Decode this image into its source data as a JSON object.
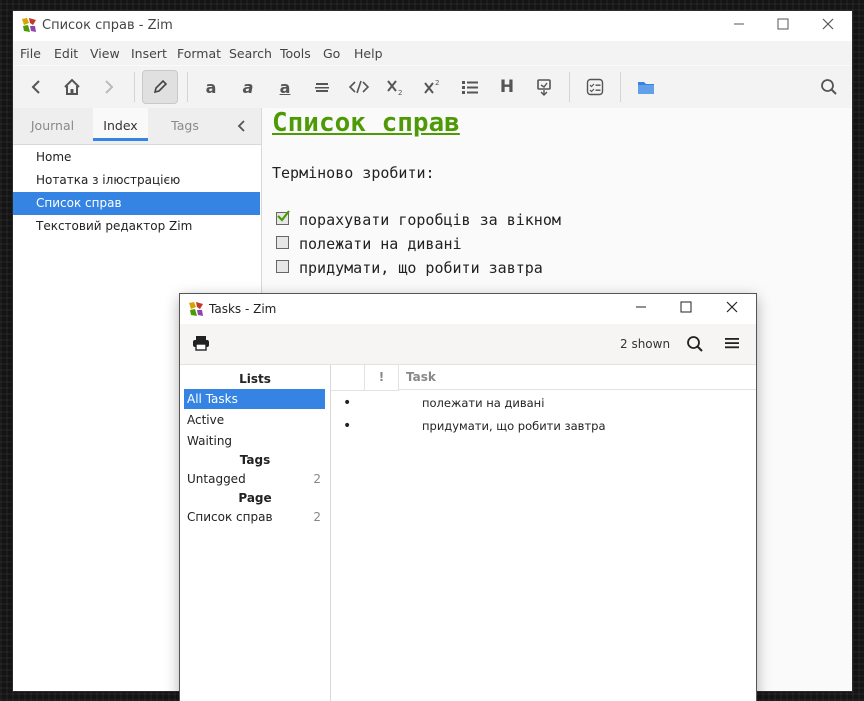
{
  "main_window": {
    "title": "Список справ - Zim",
    "menu": [
      "File",
      "Edit",
      "View",
      "Insert",
      "Format",
      "Search",
      "Tools",
      "Go",
      "Help"
    ],
    "sidebar": {
      "tabs": [
        "Journal",
        "Index",
        "Tags"
      ],
      "selected_tab": "Index",
      "items": [
        "Home",
        "Нотатка з ілюстрацією",
        "Список справ",
        "Текстовий редактор Zim"
      ],
      "selected_item": "Список справ"
    },
    "page": {
      "heading": "Список справ",
      "intro": "Терміново зробити:",
      "tasks": [
        {
          "text": "порахувати горобців за вікном",
          "done": true
        },
        {
          "text": "полежати на дивані",
          "done": false
        },
        {
          "text": "придумати, що робити завтра",
          "done": false
        }
      ]
    }
  },
  "tasks_window": {
    "title": "Tasks  -  Zim",
    "shown": "2 shown",
    "sections": {
      "lists": "Lists",
      "tags": "Tags",
      "page": "Page"
    },
    "lists": [
      "All Tasks",
      "Active",
      "Waiting"
    ],
    "selected_list": "All Tasks",
    "tags": [
      {
        "label": "Untagged",
        "count": "2"
      }
    ],
    "pages": [
      {
        "label": "Список справ",
        "count": "2"
      }
    ],
    "columns": {
      "priority": "!",
      "task": "Task"
    },
    "rows": [
      {
        "bullet": "•",
        "task": "полежати на дивані"
      },
      {
        "bullet": "•",
        "task": "придумати, що робити завтра"
      }
    ]
  },
  "colors": {
    "accent": "#3584e4",
    "heading_green": "#4e9a06"
  }
}
